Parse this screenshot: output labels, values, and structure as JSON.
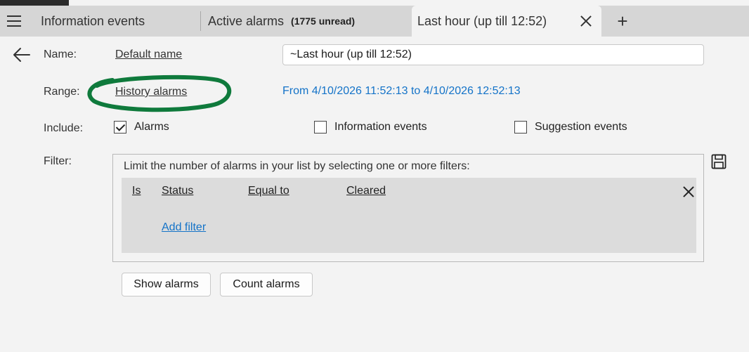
{
  "tabs": {
    "menu_icon": "hamburger-icon",
    "items": [
      {
        "label": "Information events",
        "badge": ""
      },
      {
        "label": "Active alarms",
        "badge": "(1775 unread)"
      },
      {
        "label": "Last hour (up till 12:52)",
        "badge": ""
      }
    ],
    "add_icon": "plus-icon",
    "add_label": "+"
  },
  "form": {
    "name_label": "Name:",
    "name_link": "Default name",
    "name_value": "~Last hour (up till 12:52)",
    "range_label": "Range:",
    "range_link": "History alarms",
    "range_text": "From 4/10/2026 11:52:13 to 4/10/2026 12:52:13",
    "include_label": "Include:",
    "include": [
      {
        "label": "Alarms",
        "checked": true
      },
      {
        "label": "Information events",
        "checked": false
      },
      {
        "label": "Suggestion events",
        "checked": false
      }
    ],
    "filter_label": "Filter:",
    "filter_hint": "Limit the number of alarms in your list by selecting one or more filters:",
    "filter_row": {
      "is": "Is",
      "field": "Status",
      "op": "Equal to",
      "value": "Cleared"
    },
    "add_filter": "Add filter"
  },
  "buttons": {
    "show": "Show alarms",
    "count": "Count alarms"
  },
  "colors": {
    "accent_link": "#1473c8",
    "annotation_ellipse": "#0f7a3c"
  }
}
